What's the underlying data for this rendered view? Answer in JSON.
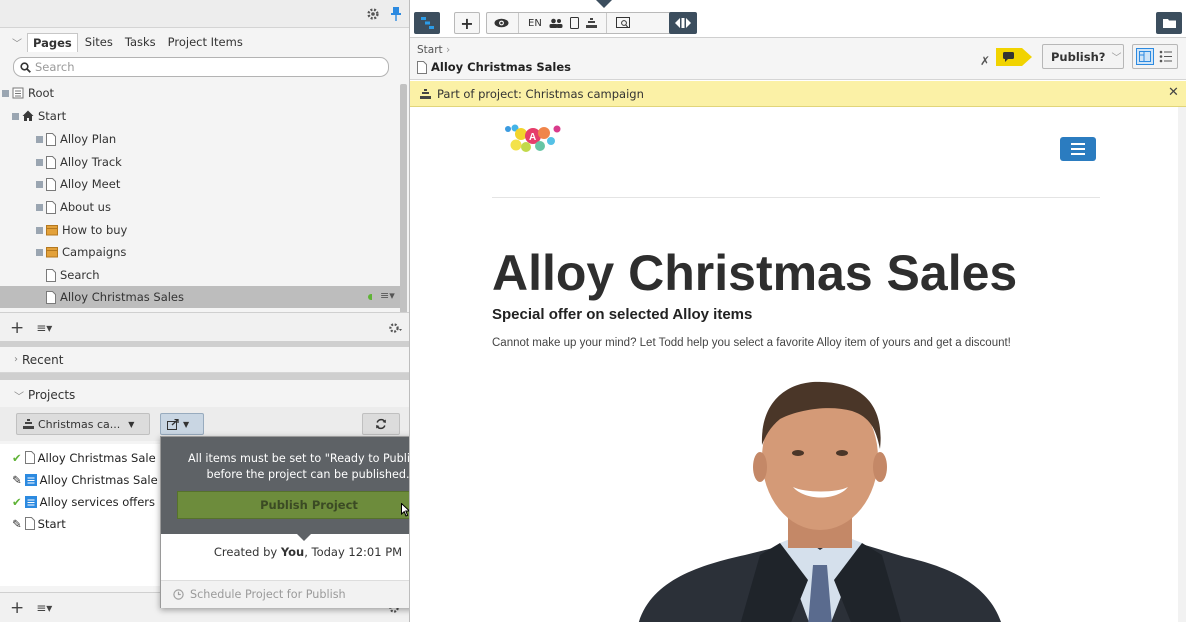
{
  "left_panel": {
    "tabs": [
      "Pages",
      "Sites",
      "Tasks",
      "Project Items"
    ],
    "search_placeholder": "Search",
    "tree": [
      {
        "label": "Root",
        "icon": "root-icon"
      },
      {
        "label": "Start",
        "icon": "home-icon"
      },
      {
        "label": "Alloy Plan",
        "icon": "page-icon"
      },
      {
        "label": "Alloy Track",
        "icon": "page-icon"
      },
      {
        "label": "Alloy Meet",
        "icon": "page-icon"
      },
      {
        "label": "About us",
        "icon": "page-icon"
      },
      {
        "label": "How to buy",
        "icon": "container-icon"
      },
      {
        "label": "Campaigns",
        "icon": "container-icon"
      },
      {
        "label": "Search",
        "icon": "page-icon"
      },
      {
        "label": "Alloy Christmas Sales",
        "icon": "page-icon",
        "selected": true
      }
    ],
    "recent_label": "Recent",
    "projects_label": "Projects",
    "project_select": "Christmas ca...",
    "project_items": [
      {
        "status": "ready",
        "label": "Alloy Christmas Sale"
      },
      {
        "status": "edit",
        "label": "Alloy Christmas Sale"
      },
      {
        "status": "ready",
        "label": "Alloy services offers"
      },
      {
        "status": "edit",
        "label": "Start"
      }
    ]
  },
  "popover": {
    "message_line1": "All items must be set to \"Ready to Publish\"",
    "message_line2": "before the project can be published.",
    "publish_button": "Publish Project",
    "created_prefix": "Created by ",
    "created_user": "You",
    "created_suffix": ", Today 12:01 PM",
    "schedule_label": "Schedule Project for Publish"
  },
  "toolbar": {
    "language": "EN"
  },
  "breadcrumb": {
    "parent": "Start",
    "title": "Alloy Christmas Sales"
  },
  "publish_menu": "Publish?",
  "notice": {
    "text": "Part of project: Christmas campaign"
  },
  "page": {
    "heading": "Alloy Christmas Sales",
    "subheading": "Special offer on selected Alloy items",
    "paragraph": "Cannot make up your mind? Let Todd help you select a favorite Alloy item of yours and get a discount!"
  },
  "colors": {
    "accent_dark": "#3c4e5e",
    "notice_bg": "#fbf1a6",
    "publish_green": "#6d8c3c",
    "check_green": "#5fb336",
    "comment_yellow": "#f1d300",
    "menu_blue": "#2b7cc0"
  }
}
